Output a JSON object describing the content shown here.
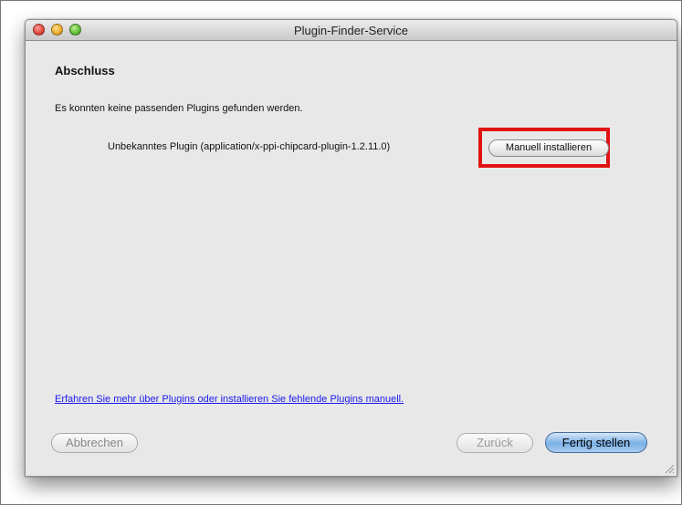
{
  "window": {
    "title": "Plugin-Finder-Service"
  },
  "content": {
    "heading": "Abschluss",
    "message": "Es konnten keine passenden Plugins gefunden werden.",
    "plugin_label": "Unbekanntes Plugin (application/x-ppi-chipcard-plugin-1.2.11.0)",
    "manual_install_label": "Manuell installieren",
    "learn_more_link": "Erfahren Sie mehr über Plugins oder installieren Sie fehlende Plugins manuell."
  },
  "footer": {
    "cancel_label": "Abbrechen",
    "back_label": "Zurück",
    "finish_label": "Fertig stellen"
  },
  "colors": {
    "highlight": "#e11212",
    "link": "#1a1aee",
    "default_button": "#7ab0e6"
  },
  "icons": {
    "close": "close-button-icon",
    "minimize": "minimize-button-icon",
    "zoom": "zoom-button-icon",
    "resize": "resize-grip-icon"
  }
}
